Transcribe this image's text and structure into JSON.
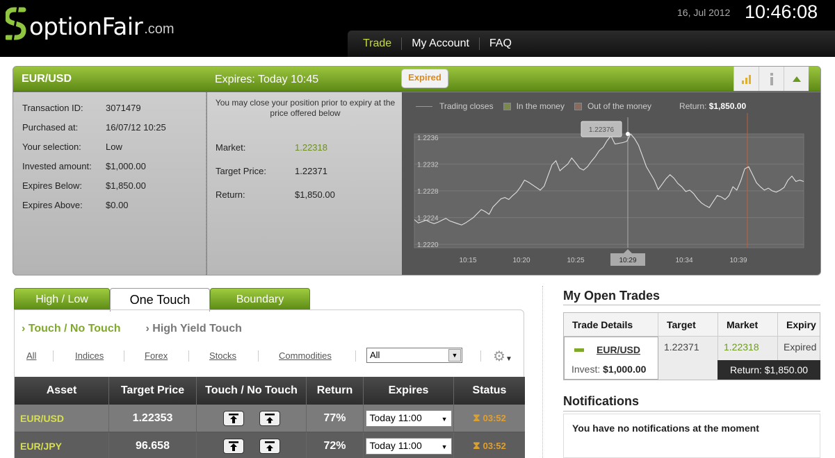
{
  "brand": {
    "logo_text": "optionFair",
    "logo_suffix": ".com"
  },
  "clock": {
    "date": "16, Jul 2012",
    "time": "10:46:08"
  },
  "nav": [
    {
      "label": "Trade"
    },
    {
      "label": "My Account"
    },
    {
      "label": "FAQ"
    }
  ],
  "trade": {
    "pair": "EUR/USD",
    "expires": "Expires:  Today 10:45",
    "badge": "Expired",
    "details": [
      {
        "label": "Transaction ID:",
        "value": "3071479"
      },
      {
        "label": "Purchased at:",
        "value": "16/07/12 10:25"
      },
      {
        "label": "Your selection:",
        "value": "Low"
      },
      {
        "label": "Invested amount:",
        "value": "$1,000.00"
      },
      {
        "label": "Expires Below:",
        "value": "$1,850.00"
      },
      {
        "label": "Expires Above:",
        "value": "$0.00"
      }
    ],
    "note": "You may close your position prior to expiry at the price offered below",
    "market_label": "Market:",
    "market_value": "1.22318",
    "target_label": "Target Price:",
    "target_value": "1.22371",
    "return_label": "Return:",
    "return_value": "$1,850.00"
  },
  "chart_legend": {
    "trading_closes": "Trading closes",
    "in_money": "In the money",
    "out_money": "Out of the money",
    "return_label": "Return:",
    "return_value": "$1,850.00",
    "in_color": "#7a8a4a",
    "out_color": "#8a6a5e"
  },
  "chart_data": {
    "type": "line",
    "title": "",
    "xlabel": "",
    "ylabel": "",
    "x_ticks": [
      "10:15",
      "10:20",
      "10:25",
      "10:29",
      "10:34",
      "10:39"
    ],
    "y_ticks": [
      "1.2236",
      "1.2232",
      "1.2228",
      "1.2224",
      "1.2220"
    ],
    "ylim": [
      1.22195,
      1.22365
    ],
    "highlight_x": "10:29",
    "tooltip": "1.22376",
    "series": [
      {
        "values": [
          1.22237,
          1.22232,
          1.22234,
          1.22236,
          1.22233,
          1.22231,
          1.22233,
          1.22236,
          1.22239,
          1.22235,
          1.22233,
          1.22231,
          1.22229,
          1.22232,
          1.22236,
          1.2224,
          1.22246,
          1.22252,
          1.22249,
          1.22245,
          1.22256,
          1.22262,
          1.22268,
          1.2227,
          1.22267,
          1.22273,
          1.22278,
          1.22286,
          1.22296,
          1.22293,
          1.22289,
          1.22285,
          1.22281,
          1.22287,
          1.22303,
          1.22319,
          1.22325,
          1.2231,
          1.22315,
          1.2232,
          1.22329,
          1.22322,
          1.22314,
          1.22311,
          1.22316,
          1.22324,
          1.22331,
          1.2234,
          1.22345,
          1.22355,
          1.22362,
          1.2235,
          1.22351,
          1.22352,
          1.22354,
          1.22365,
          1.22358,
          1.22348,
          1.22332,
          1.22316,
          1.22306,
          1.22296,
          1.22282,
          1.2229,
          1.22298,
          1.22304,
          1.22299,
          1.22291,
          1.22286,
          1.22279,
          1.22281,
          1.22276,
          1.22268,
          1.22262,
          1.22258,
          1.22255,
          1.22264,
          1.22273,
          1.22271,
          1.22267,
          1.22273,
          1.22286,
          1.22281,
          1.22295,
          1.22313,
          1.22316,
          1.22304,
          1.22292,
          1.22286,
          1.22281,
          1.22284,
          1.2228,
          1.22278,
          1.22281,
          1.22285,
          1.22296,
          1.22302,
          1.22294,
          1.22296,
          1.22294
        ]
      }
    ]
  },
  "tabs": [
    {
      "label": "High / Low"
    },
    {
      "label": "One Touch"
    },
    {
      "label": "Boundary"
    }
  ],
  "subtabs": [
    {
      "label": "Touch / No Touch"
    },
    {
      "label": "High Yield Touch"
    }
  ],
  "filters": [
    {
      "label": "All"
    },
    {
      "label": "Indices"
    },
    {
      "label": "Forex"
    },
    {
      "label": "Stocks"
    },
    {
      "label": "Commodities"
    }
  ],
  "filter_select": "All",
  "table": {
    "headers": [
      "Asset",
      "Target Price",
      "Touch / No Touch",
      "Return",
      "Expires",
      "Status"
    ],
    "rows": [
      {
        "asset": "EUR/USD",
        "target": "1.22353",
        "ret": "77%",
        "expires": "Today 11:00",
        "status": "03:52"
      },
      {
        "asset": "EUR/JPY",
        "target": "96.658",
        "ret": "72%",
        "expires": "Today 11:00",
        "status": "03:52"
      }
    ]
  },
  "open_trades": {
    "title": "My Open Trades",
    "headers": [
      "Trade Details",
      "Target",
      "Market",
      "Expiry"
    ],
    "pair": "EUR/USD",
    "invest_label": "Invest:",
    "invest_value": "$1,000.00",
    "target": "1.22371",
    "market": "1.22318",
    "expiry": "Expired",
    "return": "Return: $1,850.00"
  },
  "notifications": {
    "title": "Notifications",
    "message": "You have no notifications at the moment"
  }
}
